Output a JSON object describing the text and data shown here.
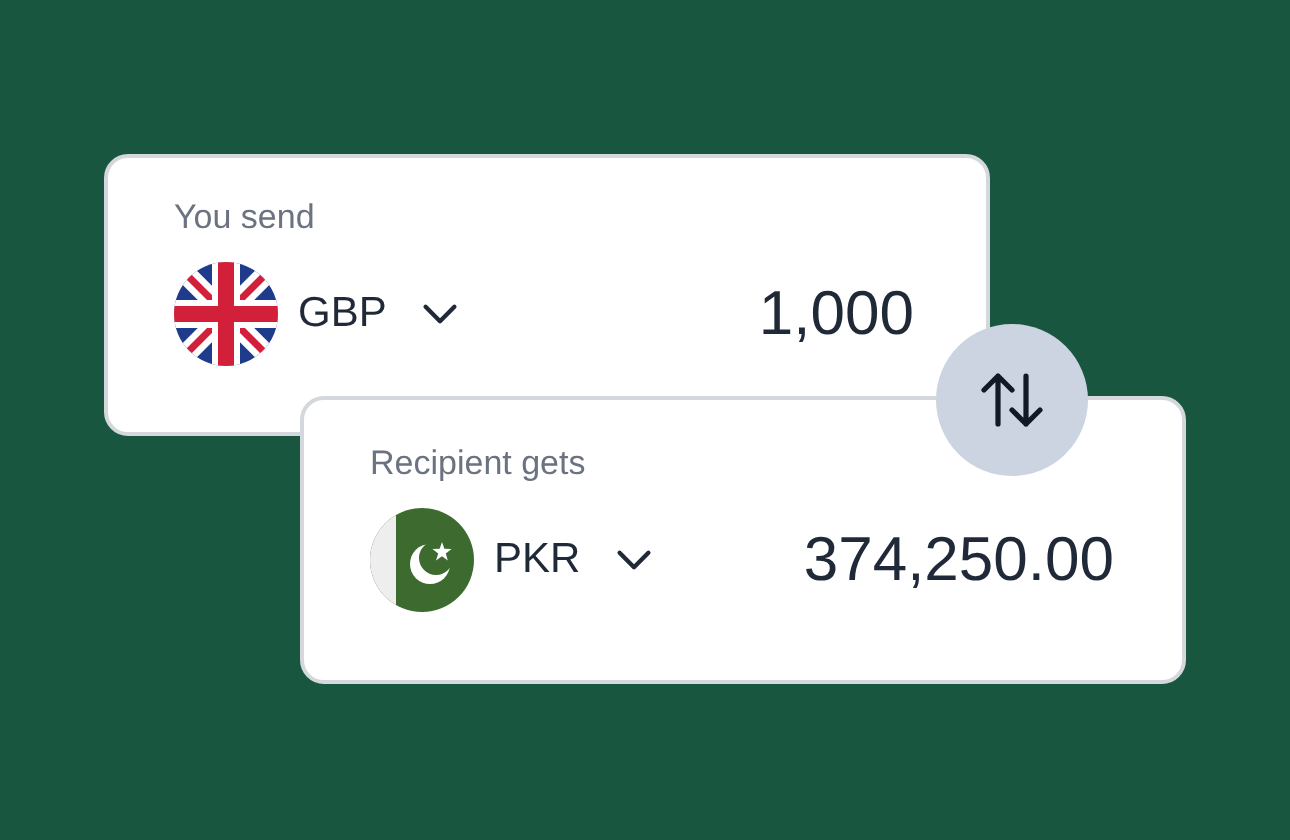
{
  "cards": [
    {
      "label": "You send",
      "currency": "GBP",
      "amount": "1,000"
    },
    {
      "label": "Recipient gets",
      "currency": "PKR",
      "amount": "374,250.00"
    }
  ]
}
